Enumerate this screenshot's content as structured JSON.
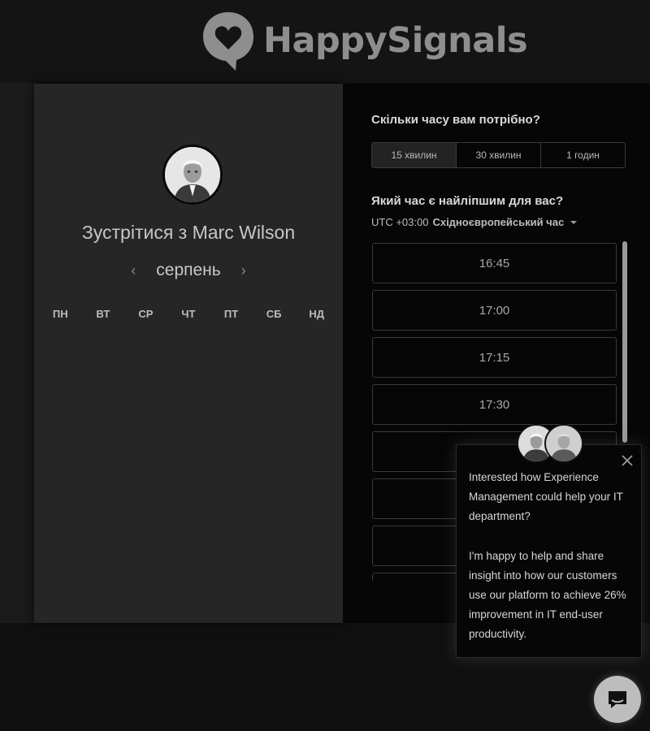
{
  "header": {
    "logo_text": "HappySignals",
    "logo_icon": "heart-speech-bubble-icon"
  },
  "scheduler": {
    "host": {
      "title": "Зустрітися з Marc Wilson",
      "avatar": "host-avatar"
    },
    "calendar": {
      "month": "серпень",
      "prev_icon": "chevron-left-icon",
      "next_icon": "chevron-right-icon",
      "weekdays": [
        "ПН",
        "ВТ",
        "СР",
        "ЧТ",
        "ПТ",
        "СБ",
        "НД"
      ]
    },
    "duration": {
      "question": "Скільки часу вам потрібно?",
      "options": [
        "15 хвилин",
        "30 хвилин",
        "1 годин"
      ],
      "selected": "15 хвилин"
    },
    "time": {
      "question": "Який час є найліпшим для вас?",
      "tz_offset": "UTC +03:00",
      "tz_name": "Східноєвропейський час",
      "slots": [
        "16:45",
        "17:00",
        "17:15",
        "17:30",
        "",
        "",
        "",
        ""
      ]
    }
  },
  "chat": {
    "message_1": "Interested how Experience Management could help your IT department?",
    "message_2": "I'm happy to help and share insight into how our customers use our platform to achieve 26% improvement in IT end-user productivity.",
    "close_icon": "close-icon",
    "launcher_icon": "chat-bubble-icon"
  },
  "colors": {
    "page_bg": "#0d0d0d",
    "card_bg": "#262626",
    "panel_bg": "#060606",
    "logo": "#8e8e8e"
  }
}
